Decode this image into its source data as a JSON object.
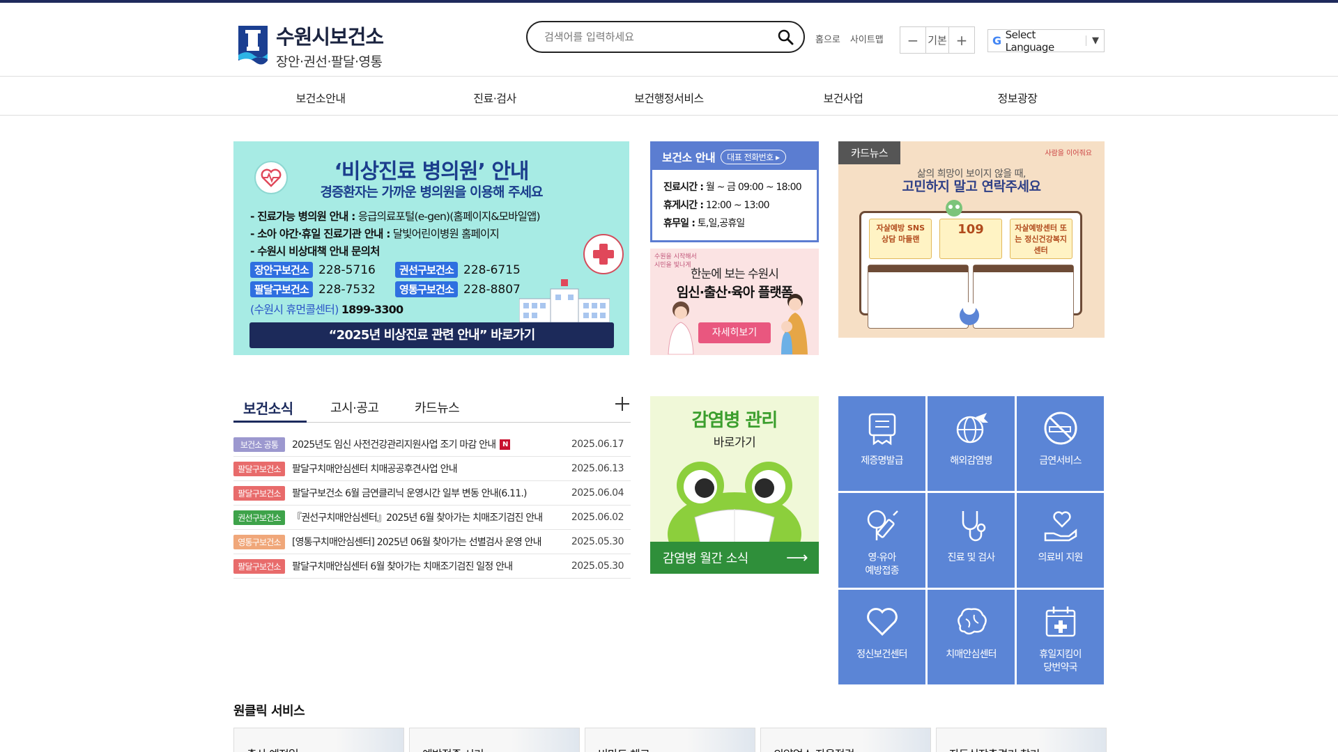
{
  "header": {
    "logo_title": "수원시보건소",
    "logo_sub": "장안·권선·팔달·영통",
    "search_placeholder": "검색어를 입력하세요",
    "util": [
      "홈으로",
      "사이트맵"
    ],
    "zoom_label": "기본",
    "zoom_minus": "−",
    "zoom_plus": "+",
    "lang_g": "G",
    "lang_label": "Select Language",
    "lang_arrow": "▼"
  },
  "nav": [
    "보건소안내",
    "진료·검사",
    "보건행정서비스",
    "보건사업",
    "정보광장"
  ],
  "banner_main": {
    "title": "‘비상진료 병의원’ 안내",
    "subtitle": "경증환자는 가까운 병의원을 이용해 주세요",
    "line1_b": "- 진료가능 병의원 안내 :",
    "line1": " 응급의료포털(e-gen)(홈페이지&모바일앱)",
    "line2_b": "- 소아 야간·휴일 진료기관 안내 :",
    "line2": " 달빛어린이병원 홈페이지",
    "line3_b": "- 수원시 비상대책 안내 문의처",
    "centers": [
      {
        "name": "장안구보건소",
        "tel": "228-5716"
      },
      {
        "name": "권선구보건소",
        "tel": "228-6715"
      },
      {
        "name": "팔달구보건소",
        "tel": "228-7532"
      },
      {
        "name": "영통구보건소",
        "tel": "228-8807"
      }
    ],
    "callcenter": "(수원시 휴먼콜센터)",
    "callcenter_tel": "1899-3300",
    "link": "“2025년 비상진료 관련 안내” 바로가기"
  },
  "info": {
    "title": "보건소 안내",
    "btn": "대표 전화번호",
    "hours_label": "진료시간 :",
    "hours": " 월 ~ 금 09:00 ~ 18:00",
    "break_label": "휴게시간 :",
    "break": " 12:00 ~ 13:00",
    "off_label": "휴무일 :",
    "off": " 토,일,공휴일"
  },
  "banner_preg": {
    "side": "수원을 시작해서\n시민을 빛나게",
    "t1": "한눈에 보는 수원시",
    "t2": "임신·출산·육아 플랫폼",
    "btn": "자세히보기"
  },
  "banner_card": {
    "label": "카드뉴스",
    "corner": "사람을 이어줘요",
    "t0": "삶의 희망이 보이지 않을 때,",
    "t1": "고민하지 말고 연락주세요",
    "chip1": "자살예방 SNS 상담 마들랜",
    "chip2": "109",
    "chip3": "자살예방센터 또는 정신건강복지센터"
  },
  "news": {
    "tabs": [
      "보건소식",
      "고시·공고",
      "카드뉴스"
    ],
    "items": [
      {
        "tag": "보건소 공통",
        "color": "#9c98cf",
        "title": "2025년도 임신 사전건강관리지원사업 조기 마감 안내",
        "new": "N",
        "date": "2025.06.17"
      },
      {
        "tag": "팔달구보건소",
        "color": "#e86b6b",
        "title": "팔달구치매안심센터 치매공공후견사업 안내",
        "new": "",
        "date": "2025.06.13"
      },
      {
        "tag": "팔달구보건소",
        "color": "#e86b6b",
        "title": "팔달구보건소 6월 금연클리닉 운영시간 일부 변동 안내(6.11.)",
        "new": "",
        "date": "2025.06.04"
      },
      {
        "tag": "권선구보건소",
        "color": "#3ea34a",
        "title": "『권선구치매안심센터』2025년 6월 찾아가는 치매조기검진 안내",
        "new": "",
        "date": "2025.06.02"
      },
      {
        "tag": "영통구보건소",
        "color": "#f0a77a",
        "title": "[영통구치매안심센터] 2025년 06월 찾아가는 선별검사 운영 안내",
        "new": "",
        "date": "2025.05.30"
      },
      {
        "tag": "팔달구보건소",
        "color": "#e86b6b",
        "title": "팔달구치매안심센터 6월 찾아가는 치매조기검진 일정 안내",
        "new": "",
        "date": "2025.05.30"
      }
    ]
  },
  "banner_inf": {
    "t1": "감염병 관리",
    "t2": "바로가기",
    "bar": "감염병 월간 소식",
    "arrow": "⟶"
  },
  "quick": [
    {
      "label": "제증명발급",
      "icon": "certificate-icon"
    },
    {
      "label": "해외감염병",
      "icon": "globe-plane-icon"
    },
    {
      "label": "금연서비스",
      "icon": "no-smoking-icon"
    },
    {
      "label": "영·유아\n예방접종",
      "icon": "vaccine-icon"
    },
    {
      "label": "진료 및 검사",
      "icon": "stethoscope-icon"
    },
    {
      "label": "의료비 지원",
      "icon": "hand-heart-icon"
    },
    {
      "label": "정신보건센터",
      "icon": "heart-icon"
    },
    {
      "label": "치매안심센터",
      "icon": "brain-icon"
    },
    {
      "label": "휴일지킴이\n당번약국",
      "icon": "calendar-cross-icon"
    }
  ],
  "oneclick": {
    "title": "원클릭 서비스",
    "cards": [
      "출산 예정일",
      "예방접종 시기",
      "비만도 체크",
      "의약업소 자율점검",
      "자동심장충격기 찾기"
    ]
  },
  "colors": {
    "navy": "#1b2a5c",
    "quick_bg": "#5b85d6",
    "banner_teal": "#a7ebe4",
    "inf_green": "#2f8f3a"
  }
}
